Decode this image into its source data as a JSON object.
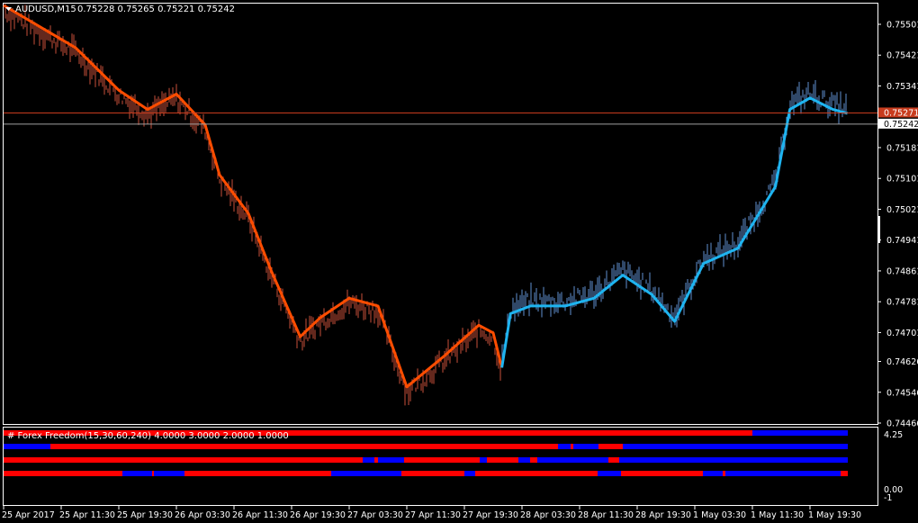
{
  "header": {
    "symbol": "AUDUSD,M15",
    "ohlc": "0.75228 0.75265 0.75221 0.75242"
  },
  "indicator": {
    "title": "# Forex Freedom(15,30,60,240) 4.0000 3.0000 2.0000 1.0000",
    "axis_labels": [
      "4.25",
      "0.00",
      "-1"
    ]
  },
  "colors": {
    "background": "#000000",
    "up": "#1eb4f0",
    "down": "#ff4d00",
    "bar_up": "#5f8fd0",
    "bar_down": "#c8503a",
    "bullish": "#0000ff",
    "bearish": "#ff0000",
    "frame": "#ffffff"
  },
  "chart_data": {
    "type": "candlestick",
    "symbol": "AUDUSD",
    "timeframe": "M15",
    "y_ticks": [
      "0.75501",
      "0.75421",
      "0.75341",
      "0.75181",
      "0.75101",
      "0.75021",
      "0.74941",
      "0.74861",
      "0.74781",
      "0.74701",
      "0.74626",
      "0.74546",
      "0.74466"
    ],
    "ylim": [
      0.74466,
      0.75501
    ],
    "price_lines": [
      {
        "label": "0.75271",
        "value": 0.75271,
        "color": "#c83c1e"
      },
      {
        "label": "0.75242",
        "value": 0.75242,
        "color": "#a0a0a0"
      }
    ],
    "x_tick_labels": [
      "25 Apr 2017",
      "25 Apr 11:30",
      "25 Apr 19:30",
      "26 Apr 03:30",
      "26 Apr 11:30",
      "26 Apr 19:30",
      "27 Apr 03:30",
      "27 Apr 11:30",
      "27 Apr 19:30",
      "28 Apr 03:30",
      "28 Apr 11:30",
      "28 Apr 19:30",
      "1 May 03:30",
      "1 May 11:30",
      "1 May 19:30"
    ],
    "series": [
      {
        "name": "trend",
        "x": [
          0,
          2.5,
          4,
          5,
          6,
          7,
          7.5,
          8.5,
          9.3,
          10.3,
          11,
          12,
          13,
          14,
          15.3,
          16.5,
          17,
          17.3
        ],
        "values": [
          0.7555,
          0.7544,
          0.7533,
          0.7528,
          0.7532,
          0.7524,
          0.7511,
          0.7501,
          0.7486,
          0.7469,
          0.7474,
          0.7479,
          0.7477,
          0.7456,
          0.7464,
          0.7472,
          0.747,
          0.7461
        ]
      },
      {
        "name": "trend",
        "x": [
          17.3,
          17.6,
          18.3,
          19.5,
          20.5,
          21.5,
          22.5,
          23.3,
          24.3,
          25.5,
          26.8,
          27.3,
          28,
          28.8,
          29.3
        ],
        "values": [
          0.7461,
          0.7475,
          0.7477,
          0.7477,
          0.7479,
          0.7485,
          0.748,
          0.7473,
          0.7488,
          0.7492,
          0.7508,
          0.7528,
          0.7531,
          0.7528,
          0.7527
        ]
      }
    ]
  }
}
